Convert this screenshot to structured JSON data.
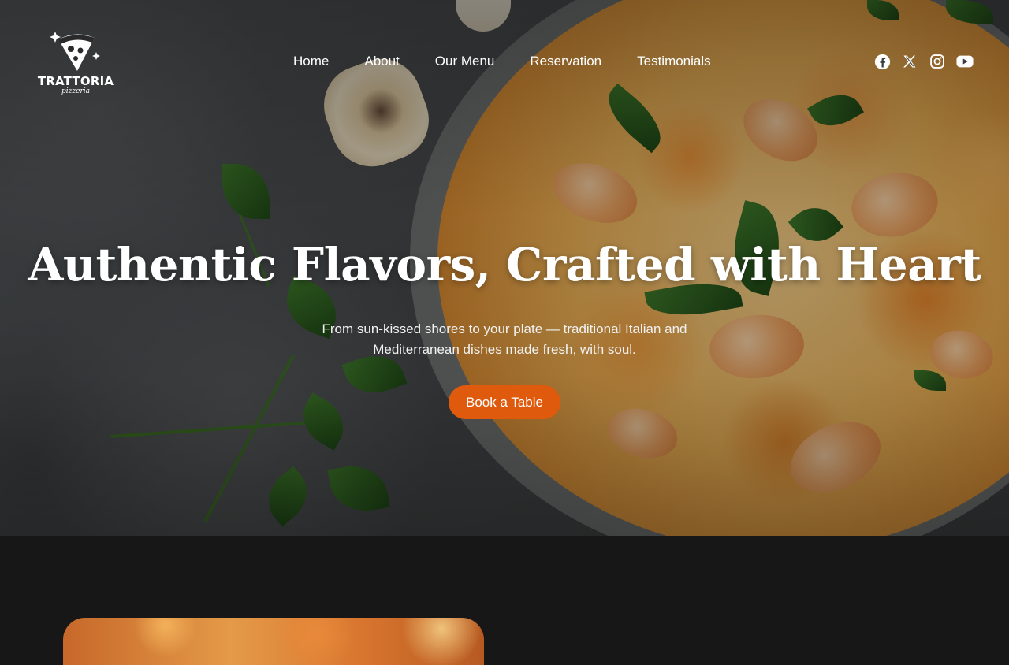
{
  "brand": {
    "name": "TRATTORIA",
    "sub": "pizzeria"
  },
  "nav": {
    "items": [
      {
        "label": "Home"
      },
      {
        "label": "About"
      },
      {
        "label": "Our Menu"
      },
      {
        "label": "Reservation"
      },
      {
        "label": "Testimonials"
      }
    ]
  },
  "socials": [
    {
      "icon": "facebook-icon"
    },
    {
      "icon": "x-icon"
    },
    {
      "icon": "instagram-icon"
    },
    {
      "icon": "youtube-icon"
    }
  ],
  "hero": {
    "title": "Authentic Flavors, Crafted with Heart",
    "subtitle": "From sun-kissed shores to your plate — traditional Italian and Mediterranean dishes made fresh, with soul.",
    "cta": "Book a Table"
  },
  "colors": {
    "accent": "#df5a0c",
    "dark_section": "#171717"
  }
}
